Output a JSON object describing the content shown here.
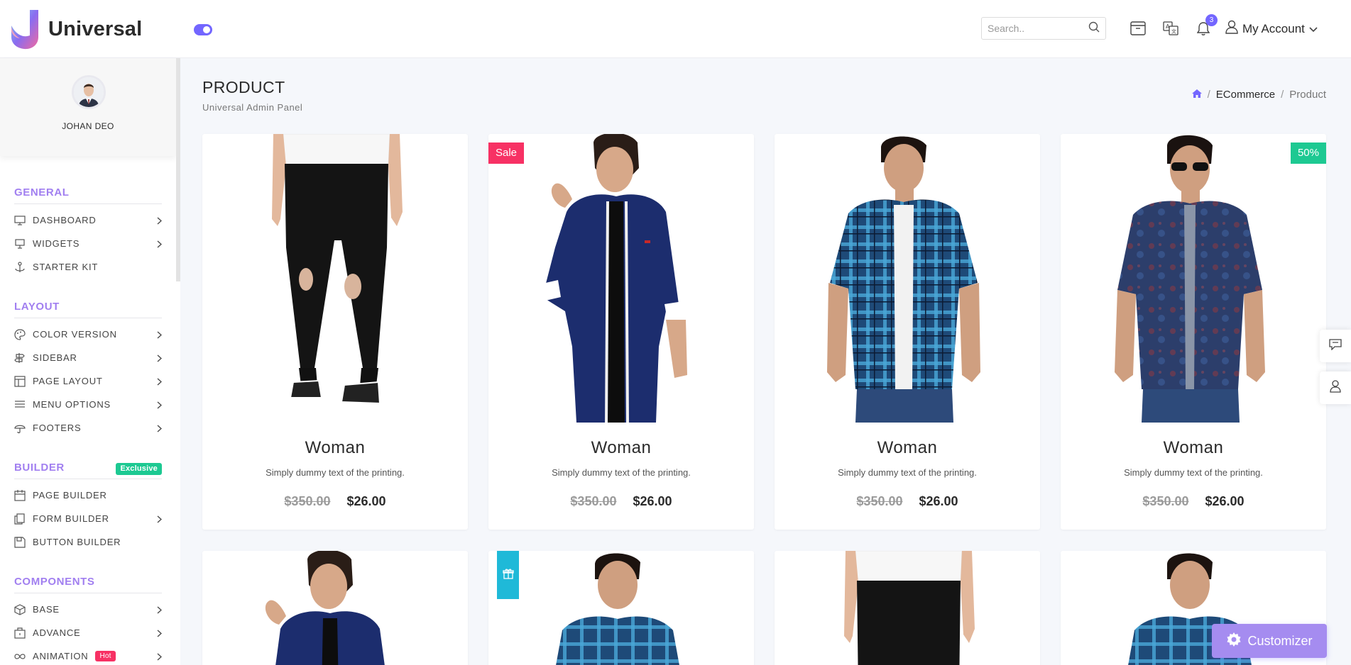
{
  "header": {
    "brand": "Universal",
    "search_placeholder": "Search..",
    "notification_count": "3",
    "account_label": "My Account"
  },
  "sidebar": {
    "user_name": "JOHAN DEO",
    "sections": [
      {
        "title": "GENERAL",
        "items": [
          {
            "label": "DASHBOARD",
            "icon": "monitor-icon",
            "has_submenu": true
          },
          {
            "label": "WIDGETS",
            "icon": "widget-icon",
            "has_submenu": true
          },
          {
            "label": "STARTER KIT",
            "icon": "anchor-icon",
            "has_submenu": false
          }
        ]
      },
      {
        "title": "LAYOUT",
        "items": [
          {
            "label": "COLOR VERSION",
            "icon": "palette-icon",
            "has_submenu": true
          },
          {
            "label": "SIDEBAR",
            "icon": "signpost-icon",
            "has_submenu": true
          },
          {
            "label": "PAGE LAYOUT",
            "icon": "layout-icon",
            "has_submenu": true
          },
          {
            "label": "MENU OPTIONS",
            "icon": "list-icon",
            "has_submenu": true
          },
          {
            "label": "FOOTERS",
            "icon": "umbrella-icon",
            "has_submenu": true
          }
        ]
      },
      {
        "title": "BUILDER",
        "badge": "Exclusive",
        "items": [
          {
            "label": "PAGE BUILDER",
            "icon": "calendar-icon",
            "has_submenu": false
          },
          {
            "label": "FORM BUILDER",
            "icon": "copy-icon",
            "has_submenu": true
          },
          {
            "label": "BUTTON BUILDER",
            "icon": "save-icon",
            "has_submenu": false
          }
        ]
      },
      {
        "title": "COMPONENTS",
        "items": [
          {
            "label": "BASE",
            "icon": "box-icon",
            "has_submenu": true
          },
          {
            "label": "ADVANCE",
            "icon": "briefcase-icon",
            "has_submenu": true
          },
          {
            "label": "ANIMATION",
            "icon": "infinity-icon",
            "has_submenu": true,
            "badge": "Hot"
          }
        ]
      }
    ]
  },
  "page": {
    "title": "PRODUCT",
    "subtitle": "Universal Admin Panel",
    "breadcrumb": [
      "ECommerce",
      "Product"
    ]
  },
  "products": [
    {
      "title": "Woman",
      "desc": "Simply dummy text of the printing.",
      "old_price": "$350.00",
      "new_price": "$26.00",
      "ribbon": ""
    },
    {
      "title": "Woman",
      "desc": "Simply dummy text of the printing.",
      "old_price": "$350.00",
      "new_price": "$26.00",
      "ribbon": "Sale"
    },
    {
      "title": "Woman",
      "desc": "Simply dummy text of the printing.",
      "old_price": "$350.00",
      "new_price": "$26.00",
      "ribbon": ""
    },
    {
      "title": "Woman",
      "desc": "Simply dummy text of the printing.",
      "old_price": "$350.00",
      "new_price": "$26.00",
      "ribbon": "50%"
    }
  ],
  "customizer_label": "Customizer",
  "colors": {
    "accent": "#7366ff",
    "section_title": "#a17ff0",
    "sale": "#f73164",
    "discount": "#1dc992",
    "gift": "#1fb9d8"
  }
}
